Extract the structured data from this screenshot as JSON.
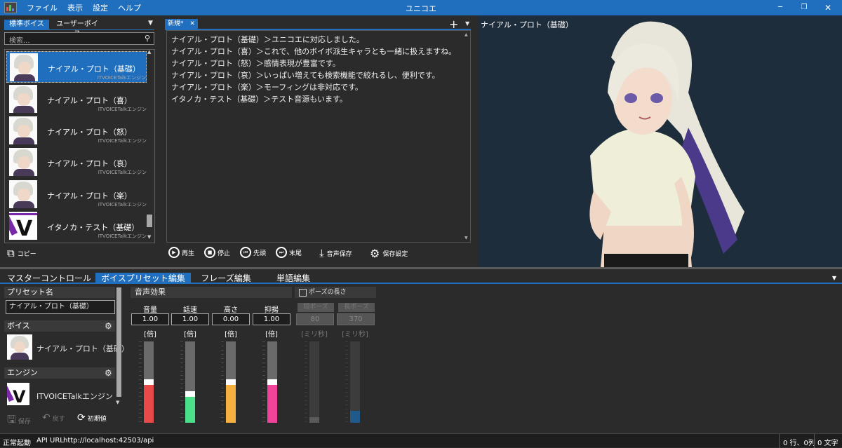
{
  "menu": {
    "file": "ファイル",
    "view": "表示",
    "settings": "設定",
    "help": "ヘルプ"
  },
  "app_title": "ユニコエ",
  "left": {
    "tabs": [
      "標準ボイス",
      "ユーザーボイス"
    ],
    "search_placeholder": "検索...",
    "voices": [
      {
        "name": "ナイアル・プロト（基礎）",
        "engine": "ITVOICETalkエンジン"
      },
      {
        "name": "ナイアル・プロト（喜）",
        "engine": "ITVOICETalkエンジン"
      },
      {
        "name": "ナイアル・プロト（怒）",
        "engine": "ITVOICETalkエンジン"
      },
      {
        "name": "ナイアル・プロト（哀）",
        "engine": "ITVOICETalkエンジン"
      },
      {
        "name": "ナイアル・プロト（楽）",
        "engine": "ITVOICETalkエンジン"
      },
      {
        "name": "イタノカ・テスト（基礎）",
        "engine": "ITVOICETalkエンジン"
      }
    ],
    "copy": "コピー"
  },
  "editor": {
    "tab": "新規*",
    "lines": [
      "ナイアル・プロト（基礎）＞ユニコエに対応しました。",
      "ナイアル・プロト（喜）＞これで、他のボイボ派生キャラとも一緒に扱えますね。",
      "ナイアル・プロト（怒）＞感情表現が豊富です。",
      "ナイアル・プロト（哀）＞いっぱい増えても検索機能で絞れるし、便利です。",
      "ナイアル・プロト（楽）＞モーフィングは非対応です。",
      "イタノカ・テスト（基礎）＞テスト音源もいます。"
    ],
    "controls": {
      "play": "再生",
      "stop": "停止",
      "start": "先頭",
      "end": "末尾",
      "save_audio": "音声保存",
      "save_settings": "保存設定"
    }
  },
  "character": {
    "name": "ナイアル・プロト（基礎）"
  },
  "bottom": {
    "tabs": [
      "マスターコントロール",
      "ボイスプリセット編集",
      "フレーズ編集",
      "単語編集"
    ],
    "preset": {
      "name_label": "プリセット名",
      "name_value": "ナイアル・プロト（基礎）",
      "voice_label": "ボイス",
      "voice_name": "ナイアル・プロト（基礎）",
      "engine_label": "エンジン",
      "engine_name": "ITVOICETalkエンジン",
      "save": "保存",
      "revert": "戻す",
      "reset": "初期値"
    },
    "effects": {
      "title": "音声効果",
      "params": [
        {
          "label": "音量",
          "value": "1.00",
          "unit": "[倍]",
          "level": 0.5,
          "color": "#e84a4a"
        },
        {
          "label": "話速",
          "value": "1.00",
          "unit": "[倍]",
          "level": 0.35,
          "color": "#4ae08a"
        },
        {
          "label": "高さ",
          "value": "0.00",
          "unit": "[倍]",
          "level": 0.5,
          "color": "#f5b040"
        },
        {
          "label": "抑揚",
          "value": "1.00",
          "unit": "[倍]",
          "level": 0.5,
          "color": "#f0449a"
        }
      ]
    },
    "pause": {
      "checkbox_label": "ポーズの長さ",
      "short_label": "短ポーズ",
      "long_label": "長ポーズ",
      "short_value": "80",
      "long_value": "370",
      "unit": "[ミリ秒]",
      "short_level": 0.07,
      "long_level": 0.15
    }
  },
  "status": {
    "left": "正常起動",
    "api_label": "API URL",
    "api_url": "http://localhost:42503/api",
    "position": "0 行、0列",
    "chars": "0 文字"
  },
  "colors": {
    "accent": "#1f6fbe",
    "background": "#2b2b2b"
  }
}
